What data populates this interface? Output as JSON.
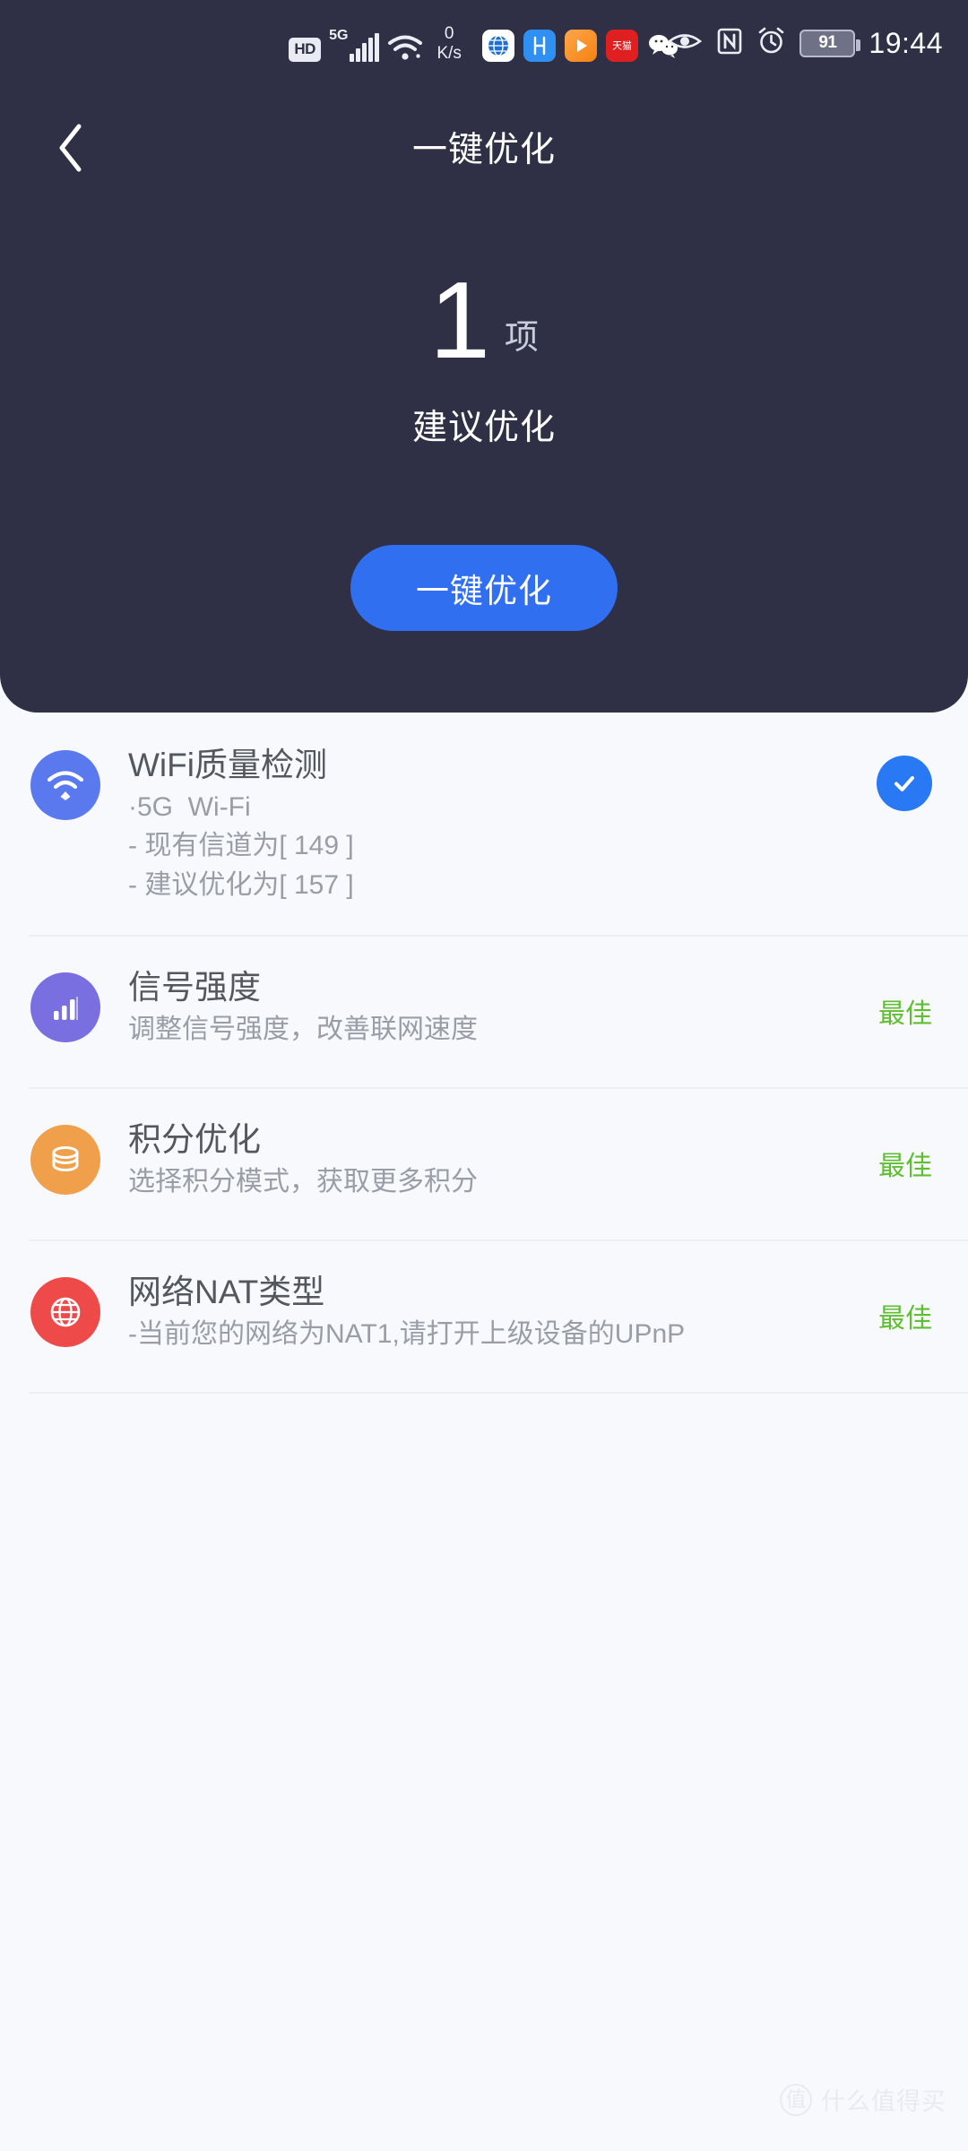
{
  "status_bar": {
    "hd_label": "HD",
    "network_label": "5G",
    "signal_bars": 5,
    "wifi_icon": "wifi-icon",
    "net_speed_value": "0",
    "net_speed_unit": "K/s",
    "app_icons": [
      {
        "name": "browser-globe-icon",
        "glyph": "⊕"
      },
      {
        "name": "app-h-icon",
        "glyph": "H"
      },
      {
        "name": "video-play-icon",
        "glyph": "▶"
      },
      {
        "name": "tmall-icon",
        "glyph": "天猫"
      },
      {
        "name": "wechat-icon",
        "glyph": "●●"
      }
    ],
    "eye_icon": "eye-comfort-icon",
    "nfc_icon": "nfc-icon",
    "alarm_icon": "alarm-clock-icon",
    "battery_level": "91",
    "time": "19:44"
  },
  "nav": {
    "back_icon": "back-chevron-icon",
    "title": "一键优化"
  },
  "hero": {
    "count": "1",
    "count_unit": "项",
    "subtitle": "建议优化",
    "cta_label": "一键优化",
    "cta_color": "#2f6ff0",
    "panel_color": "#2f3046"
  },
  "list": {
    "items": [
      {
        "icon": "wifi-signal-icon",
        "icon_color": "#5a79ef",
        "title": "WiFi质量检测",
        "desc_lines": [
          "·5G  Wi-Fi",
          "- 现有信道为[ 149 ]",
          "- 建议优化为[ 157 ]"
        ],
        "trailing_type": "check",
        "trailing_icon": "check-circle-icon",
        "trailing_color": "#2979f5",
        "status": ""
      },
      {
        "icon": "signal-bars-icon",
        "icon_color": "#7a6fe0",
        "title": "信号强度",
        "desc_lines": [
          "调整信号强度，改善联网速度"
        ],
        "trailing_type": "status",
        "status": "最佳",
        "status_color": "#5fbf2f"
      },
      {
        "icon": "coins-stack-icon",
        "icon_color": "#f0a04a",
        "title": "积分优化",
        "desc_lines": [
          "选择积分模式，获取更多积分"
        ],
        "trailing_type": "status",
        "status": "最佳",
        "status_color": "#5fbf2f"
      },
      {
        "icon": "globe-network-icon",
        "icon_color": "#ef4a4a",
        "title": "网络NAT类型",
        "desc_lines": [
          "-当前您的网络为NAT1,请打开上级设备的UPnP"
        ],
        "trailing_type": "status",
        "status": "最佳",
        "status_color": "#5fbf2f"
      }
    ]
  },
  "watermark": {
    "logo_glyph": "值",
    "text": "什么值得买"
  }
}
